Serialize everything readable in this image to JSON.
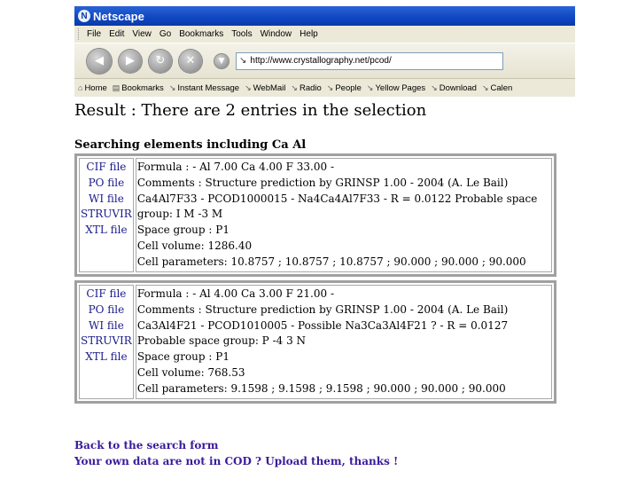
{
  "browser": {
    "title": "Netscape",
    "menu": [
      "File",
      "Edit",
      "View",
      "Go",
      "Bookmarks",
      "Tools",
      "Window",
      "Help"
    ],
    "url": "http://www.crystallography.net/pcod/",
    "bookmarks": [
      "Home",
      "Bookmarks",
      "Instant Message",
      "WebMail",
      "Radio",
      "People",
      "Yellow Pages",
      "Download",
      "Calen"
    ]
  },
  "page": {
    "result": "Result : There are 2 entries in the selection",
    "searching": "Searching elements including Ca Al",
    "entries": [
      {
        "files": [
          "CIF file",
          "PO file",
          "WI file",
          "STRUVIR",
          "XTL file"
        ],
        "formula": "Formula : - Al 7.00 Ca 4.00 F 33.00 -",
        "comments": "Comments : Structure prediction by GRINSP 1.00 - 2004 (A. Le Bail) Ca4Al7F33 - PCOD1000015 - Na4Ca4Al7F33 - R = 0.0122 Probable space group: I M -3 M",
        "space_group": "Space group : P1",
        "cell_volume": "Cell volume: 1286.40",
        "cell_parameters": "Cell parameters: 10.8757 ; 10.8757 ; 10.8757 ; 90.000 ; 90.000 ; 90.000"
      },
      {
        "files": [
          "CIF file",
          "PO file",
          "WI file",
          "STRUVIR",
          "XTL file"
        ],
        "formula": "Formula : - Al 4.00 Ca 3.00 F 21.00 -",
        "comments": "Comments : Structure prediction by GRINSP 1.00 - 2004 (A. Le Bail) Ca3Al4F21 - PCOD1010005 - Possible Na3Ca3Al4F21 ? - R = 0.0127 Probable space group: P -4 3 N",
        "space_group": "Space group : P1",
        "cell_volume": "Cell volume: 768.53",
        "cell_parameters": "Cell parameters: 9.1598 ; 9.1598 ; 9.1598 ; 90.000 ; 90.000 ; 90.000"
      }
    ],
    "links": {
      "back": "Back to the search form",
      "upload": "Your own data are not in COD ? Upload them, thanks !"
    }
  }
}
